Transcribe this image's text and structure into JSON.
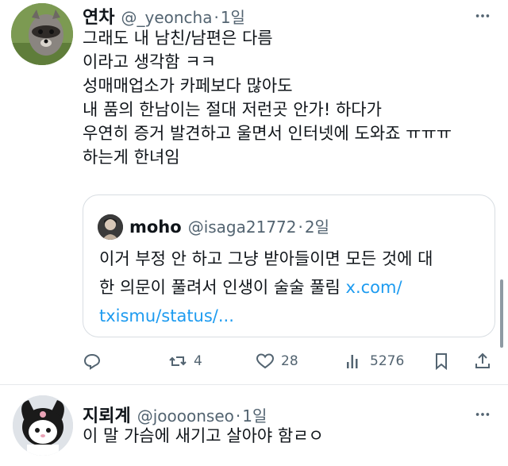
{
  "post1": {
    "name": "연차",
    "handle": "@_yeoncha",
    "separator": "·",
    "time": "1일",
    "lines": [
      "그래도 내 남친/남편은 다름",
      "이라고 생각함 ㅋㅋ",
      "성매매업소가 카페보다 많아도",
      "내 품의 한남이는 절대 저런곳 안가! 하다가",
      "우연히 증거 발견하고 울면서 인터넷에 도와죠 ㅠㅠㅠ",
      "하는게 한녀임"
    ],
    "quote": {
      "name": "moho",
      "handle": "@isaga21772",
      "separator": "·",
      "time": "2일",
      "line1": "이거 부정 안 하고 그냥 받아들이면 모든 것에 대",
      "line2_text": "한 의문이 풀려서 인생이 술술 풀림 ",
      "line2_link": "x.com/",
      "line3_link": "txismu/status/..."
    },
    "actions": {
      "reply_count": "",
      "retweet_count": "4",
      "like_count": "28",
      "views_count": "5276"
    }
  },
  "post2": {
    "name": "지뢰계",
    "handle": "@joooonseo",
    "separator": "·",
    "time": "1일",
    "text": "이 말 가슴에 새기고 살아야 함ㄹㅇ"
  },
  "icons": {
    "more": "more-dots-icon",
    "reply": "reply-icon",
    "retweet": "retweet-icon",
    "like": "heart-icon",
    "views": "views-icon",
    "bookmark": "bookmark-icon",
    "share": "share-icon"
  },
  "colors": {
    "text": "#0f1419",
    "secondary": "#536471",
    "link": "#1d9bf0",
    "border": "#d8dde2"
  }
}
